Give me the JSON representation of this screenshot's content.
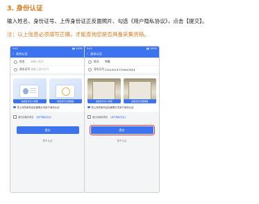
{
  "section_title": "3. 身份认证",
  "instruction": "输入姓名、身份证号、上传身份证正反面照片、勾选《用户隐私协议》，点击【提交】。",
  "note": "注：以上信息必须填写正确，才能查询您是否具备采集资格。",
  "phones": {
    "left": {
      "status_time": "9:41",
      "status_icons": "▮▮ 100%",
      "nav_title": "身份认证",
      "name_label": "姓名",
      "name_value": "请输入姓名",
      "id_label": "身份证号",
      "id_value": "请输入身份证号",
      "front_caption": "拍摄身份证人像面",
      "back_caption": "拍摄身份证国徽面",
      "agree_text": "您上传的身份证反面照片仅用于身份认证",
      "privacy_text": "我已阅读并同意",
      "privacy_link": "《用户隐私协议》",
      "submit_label": "提交",
      "later_label": "暂不认证"
    },
    "right": {
      "status_time": "9:41",
      "status_icons": "▮▮ 100%",
      "nav_title": "身份认证",
      "name_label": "姓名",
      "name_value": "李磊",
      "id_label": "身份证号",
      "id_value": "220105197709087654",
      "front_caption": "拍摄身份证人像面",
      "back_caption": "拍摄身份证国徽面",
      "agree_text": "您上传的身份证反面照片仅用于身份认证",
      "privacy_text": "我已阅读并同意",
      "privacy_link": "《用户隐私协议》",
      "submit_label": "提交",
      "later_label": "暂不认证"
    }
  },
  "colors": {
    "accent": "#3c74f0",
    "heading": "#e07a1c",
    "highlight": "#e23b3b"
  }
}
